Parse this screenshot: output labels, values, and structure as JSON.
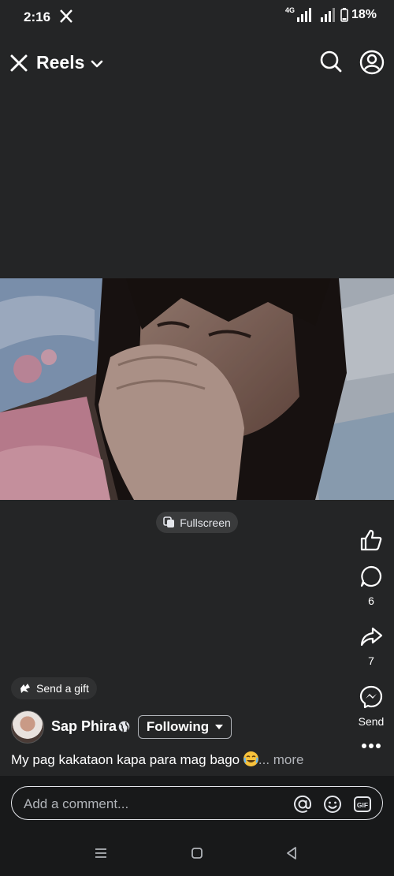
{
  "status_bar": {
    "time": "2:16",
    "network": "4G",
    "battery": "18%"
  },
  "header": {
    "title": "Reels"
  },
  "video": {
    "fullscreen_label": "Fullscreen"
  },
  "actions": {
    "comment_count": "6",
    "share_count": "7",
    "send_label": "Send"
  },
  "post": {
    "gift_label": "Send a gift",
    "author": "Sap Phira",
    "following_label": "Following",
    "caption": "My pag kakataon kapa para mag bago",
    "caption_more": "... more"
  },
  "comment": {
    "placeholder": "Add a comment..."
  },
  "colors": {
    "background": "#242526",
    "bar_background": "#18191a",
    "secondary_text": "#b0b3b8"
  }
}
